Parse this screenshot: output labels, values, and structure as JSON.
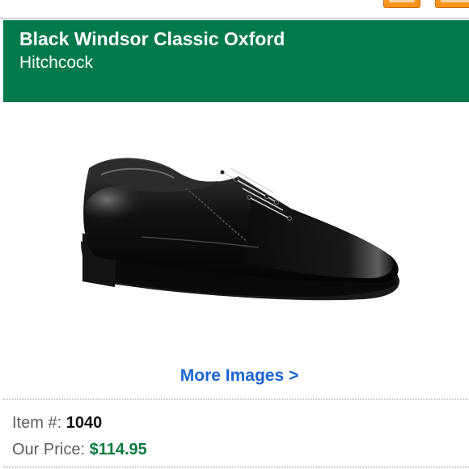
{
  "product": {
    "title": "Black Windsor Classic Oxford",
    "brand": "Hitchcock",
    "image_icon": "oxford-shoe-image"
  },
  "more_images_label": "More Images >",
  "details": {
    "item_label": "Item #:",
    "item_number": "1040",
    "price_label": "Our Price:",
    "price": "$114.95"
  },
  "colors": {
    "header_green": "#007a4a",
    "link_blue": "#1b64d1",
    "price_green": "#0a7a3f",
    "button_orange": "#f7941d"
  }
}
